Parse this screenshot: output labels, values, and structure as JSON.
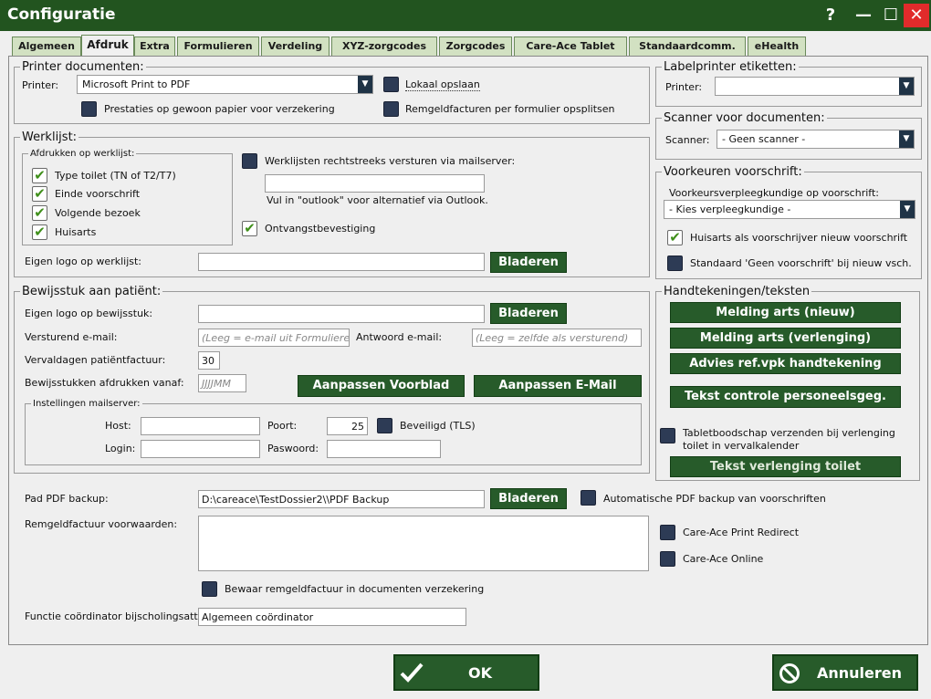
{
  "window": {
    "title": "Configuratie",
    "help": "?",
    "minimize": "—",
    "maximize": "☐",
    "close": "✕"
  },
  "tabs": [
    {
      "label": "Algemeen"
    },
    {
      "label": "Afdruk"
    },
    {
      "label": "Extra"
    },
    {
      "label": "Formulieren"
    },
    {
      "label": "Verdeling"
    },
    {
      "label": "XYZ-zorgcodes"
    },
    {
      "label": "Zorgcodes"
    },
    {
      "label": "Care-Ace Tablet"
    },
    {
      "label": "Standaardcomm."
    },
    {
      "label": "eHealth"
    }
  ],
  "printer_docs": {
    "legend": "Printer documenten:",
    "printer_label": "Printer:",
    "printer_value": "Microsoft Print to PDF",
    "local_save": "Lokaal opslaan",
    "services_plain": "Prestaties op gewoon papier voor verzekering",
    "split": "Remgeldfacturen per formulier opsplitsen"
  },
  "worklist": {
    "legend": "Werklijst:",
    "sub_legend": "Afdrukken op werklijst:",
    "items": [
      "Type toilet (TN of T2/T7)",
      "Einde voorschrift",
      "Volgende bezoek",
      "Huisarts"
    ],
    "mail_direct": "Werklijsten rechtstreeks versturen via mailserver:",
    "mail_hint": "Vul in \"outlook\" voor alternatief via Outlook.",
    "receipt": "Ontvangstbevestiging",
    "logo_label": "Eigen logo op  werklijst:",
    "browse": "Bladeren"
  },
  "receipt": {
    "legend": "Bewijsstuk aan patiënt:",
    "logo_label": "Eigen logo op bewijsstuk:",
    "browse": "Bladeren",
    "sender_label": "Versturend e-mail:",
    "sender_ph": "(Leeg = e-mail uit Formulieren)",
    "reply_label": "Antwoord e-mail:",
    "reply_ph": "(Leeg = zelfde als versturend)",
    "due_label": "Vervaldagen patiëntfactuur:",
    "due_value": "30",
    "print_from_label": "Bewijsstukken afdrukken vanaf:",
    "print_from_ph": "JJJJMM",
    "btn_cover": "Aanpassen Voorblad",
    "btn_email": "Aanpassen E-Mail",
    "mail": {
      "legend": "Instellingen mailserver:",
      "host": "Host:",
      "port": "Poort:",
      "port_value": "25",
      "secure": "Beveiligd (TLS)",
      "login": "Login:",
      "password": "Paswoord:"
    }
  },
  "bottom": {
    "pdf_label": "Pad PDF backup:",
    "pdf_value": "D:\\careace\\TestDossier2\\\\PDF Backup",
    "browse": "Bladeren",
    "auto_pdf": "Automatische PDF backup van voorschriften",
    "terms_label": "Remgeldfactuur voorwaarden:",
    "print_redirect": "Care-Ace Print Redirect",
    "online": "Care-Ace Online",
    "keep": "Bewaar remgeldfactuur in documenten verzekering",
    "coord_label": "Functie coördinator bijscholingsatt",
    "coord_value": "Algemeen coördinator"
  },
  "label_printer": {
    "legend": "Labelprinter etiketten:",
    "printer_label": "Printer:"
  },
  "scanner": {
    "legend": "Scanner voor documenten:",
    "scanner_label": "Scanner:",
    "scanner_value": "- Geen scanner -"
  },
  "prefs": {
    "legend": "Voorkeuren voorschrift:",
    "nurse_label": "Voorkeursverpleegkundige op voorschrift:",
    "nurse_value": "- Kies verpleegkundige -",
    "gp": "Huisarts als voorschrijver nieuw voorschrift",
    "no_rx": "Standaard 'Geen voorschrift' bij nieuw vsch."
  },
  "signatures": {
    "legend": "Handtekeningen/teksten",
    "buttons": [
      "Melding arts (nieuw)",
      "Melding arts (verlenging)",
      "Advies ref.vpk handtekening",
      "Tekst controle personeelsgeg."
    ],
    "tablet_msg": "Tabletboodschap verzenden bij verlenging toilet in vervalkalender",
    "extend_text": "Tekst verlenging toilet"
  },
  "footer": {
    "ok": "OK",
    "cancel": "Annuleren"
  },
  "colors": {
    "title_bg": "#22541f",
    "button_green": "#275b2a",
    "close_red": "#e12b2b",
    "checkbox_dark": "#2d3b55"
  }
}
